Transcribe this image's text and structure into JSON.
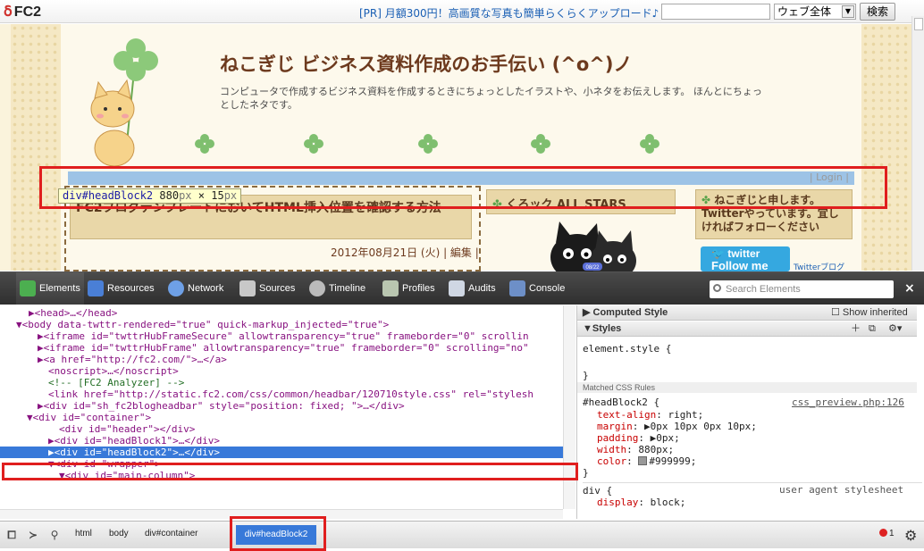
{
  "fc2bar": {
    "logo": "FC2",
    "ad_text": "[PR] 月額300円！高画質な写真も簡単らくらくアップロード♪",
    "scope_select": "ウェブ全体",
    "search_button": "検索"
  },
  "blog": {
    "title": "ねこぎじ ビジネス資料作成のお手伝い (^o^)ノ",
    "description": "コンピュータで作成するビジネス資料を作成するときにちょっとしたイラストや、小ネタをお伝えします。 ほんとにちょっとしたネタです。",
    "login_link": "| Login |",
    "inspect_tooltip": {
      "tag": "div#headBlock2",
      "width": "880",
      "height": "15",
      "unit": "px",
      "times": "×"
    },
    "post_title": "FC2ブログテンプレートにおいてHTML挿入位置を確認する方法",
    "post_date": "2012年08月21日 (火) | 編集 |",
    "mid_heading": "くろック ALL STARS",
    "right_heading": "ねこぎじと申します。Twitterやっています。宜しければフォローください",
    "twitter_button": {
      "logo": "twitter",
      "label": "Follow me"
    },
    "twitter_link": "Twitterブログ",
    "cats_badge": "08/22"
  },
  "devtools": {
    "tabs": [
      {
        "label": "Elements",
        "icon": "elements-icon"
      },
      {
        "label": "Resources",
        "icon": "resources-icon"
      },
      {
        "label": "Network",
        "icon": "network-icon"
      },
      {
        "label": "Sources",
        "icon": "sources-icon"
      },
      {
        "label": "Timeline",
        "icon": "timeline-icon"
      },
      {
        "label": "Profiles",
        "icon": "profiles-icon"
      },
      {
        "label": "Audits",
        "icon": "audits-icon"
      },
      {
        "label": "Console",
        "icon": "console-icon"
      }
    ],
    "search_placeholder": "Search Elements",
    "close": "×",
    "dom_lines": [
      "▶<head>…</head>",
      "▼<body data-twttr-rendered=\"true\" quick-markup_injected=\"true\">",
      "▶<iframe id=\"twttrHubFrameSecure\" allowtransparency=\"true\" frameborder=\"0\" scrollin",
      "▶<iframe id=\"twttrHubFrame\" allowtransparency=\"true\" frameborder=\"0\" scrolling=\"no\"",
      "▶<a href=\"http://fc2.com/\">…</a>",
      "<noscript>…</noscript>",
      "<!-- [FC2 Analyzer] -->",
      "<link href=\"http://static.fc2.com/css/common/headbar/120710style.css\" rel=\"stylesh",
      "▶<div id=\"sh_fc2blogheadbar\" style=\"position: fixed; \">…</div>",
      "▼<div id=\"container\">",
      "<div id=\"header\"></div>",
      "▶<div id=\"headBlock1\">…</div>",
      "▶<div id=\"headBlock2\">…</div>",
      "▼<div id=\"wrapper\">",
      "▼<div id=\"main-column\">"
    ],
    "styles": {
      "computed_header": "Computed Style",
      "show_inherited": "Show inherited",
      "styles_header": "Styles",
      "element_style": "element.style {",
      "element_style_close": "}",
      "matched_rules": "Matched CSS Rules",
      "rule_selector": "#headBlock2 {",
      "rule_source": "css_preview.php:126",
      "props": [
        {
          "name": "text-align",
          "value": "right;"
        },
        {
          "name": "margin",
          "value": "▶0px 10px 0px 10px;"
        },
        {
          "name": "padding",
          "value": "▶0px;"
        },
        {
          "name": "width",
          "value": "880px;"
        },
        {
          "name": "color",
          "value": "#999999;"
        }
      ],
      "rule_close": "}",
      "ua_selector": "div {",
      "ua_source": "user agent stylesheet",
      "ua_prop": {
        "name": "display",
        "value": "block;"
      }
    },
    "breadcrumbs": [
      "html",
      "body",
      "div#container"
    ],
    "active_crumb": "div#headBlock2",
    "error_count": "1",
    "gear_symbol": "⚙"
  }
}
